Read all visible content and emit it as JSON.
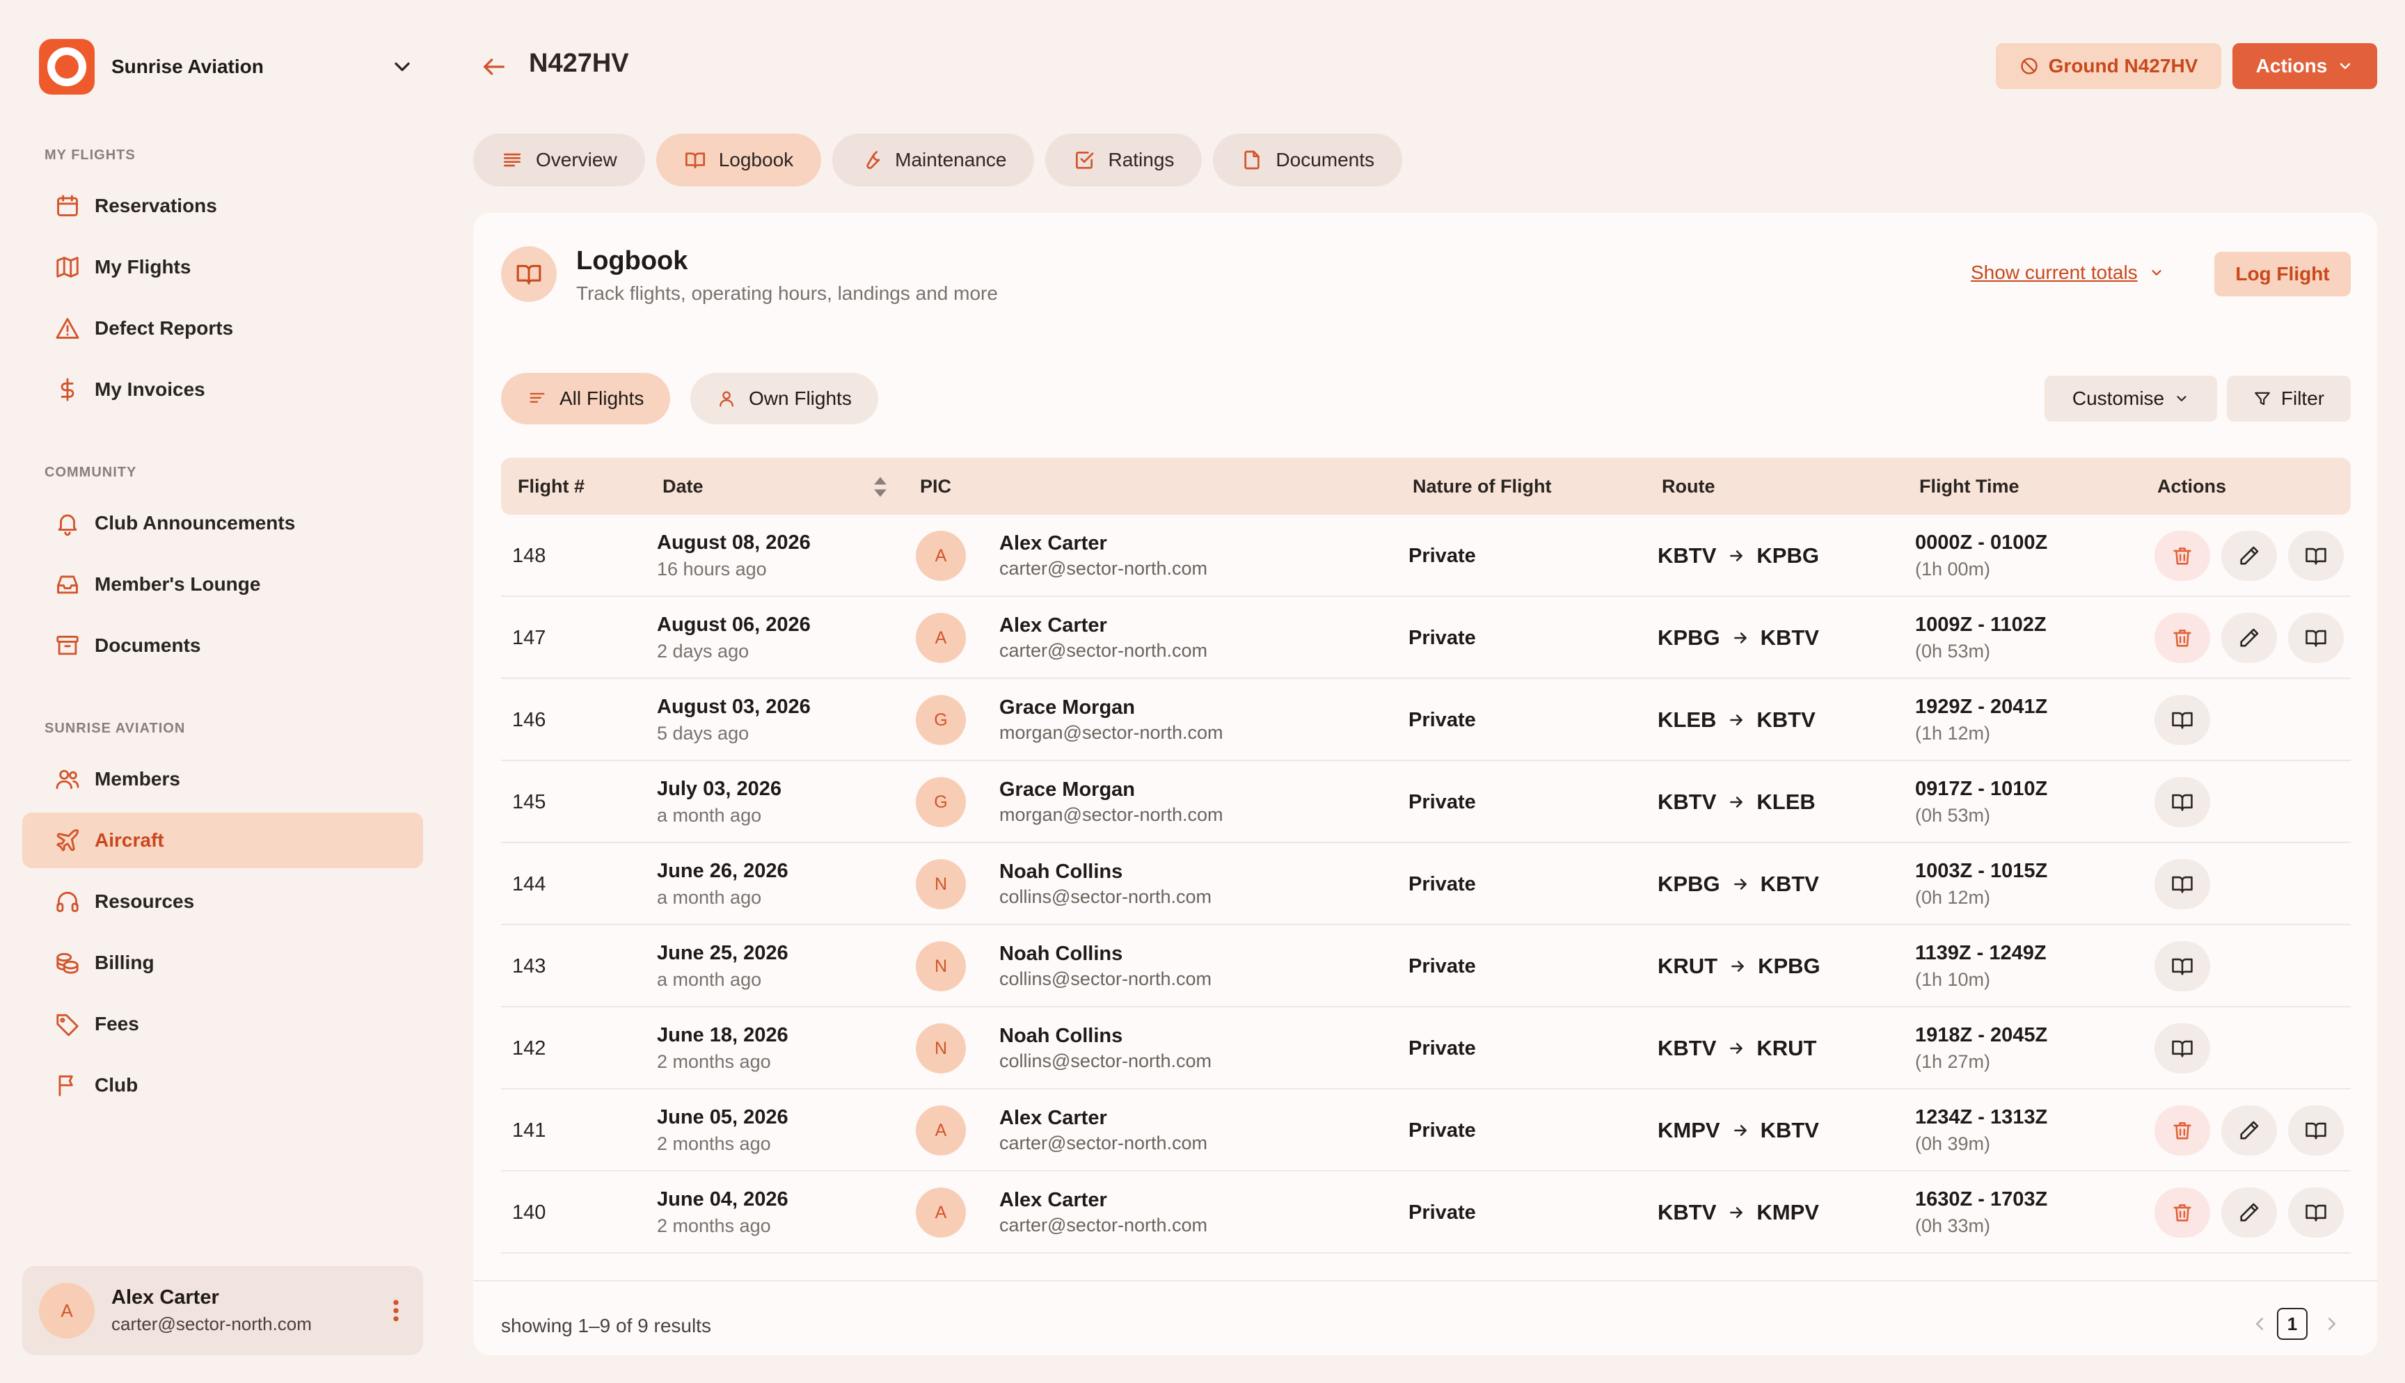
{
  "org": {
    "name": "Sunrise Aviation"
  },
  "sidebar": {
    "sections": [
      {
        "label": "MY FLIGHTS",
        "items": [
          {
            "label": "Reservations",
            "icon": "calendar-icon"
          },
          {
            "label": "My Flights",
            "icon": "map-icon"
          },
          {
            "label": "Defect Reports",
            "icon": "warning-icon"
          },
          {
            "label": "My Invoices",
            "icon": "dollar-icon"
          }
        ]
      },
      {
        "label": "COMMUNITY",
        "items": [
          {
            "label": "Club Announcements",
            "icon": "bell-icon"
          },
          {
            "label": "Member's Lounge",
            "icon": "inbox-icon"
          },
          {
            "label": "Documents",
            "icon": "archive-icon"
          }
        ]
      },
      {
        "label": "SUNRISE AVIATION",
        "items": [
          {
            "label": "Members",
            "icon": "users-icon"
          },
          {
            "label": "Aircraft",
            "icon": "plane-icon",
            "active": true
          },
          {
            "label": "Resources",
            "icon": "headphones-icon"
          },
          {
            "label": "Billing",
            "icon": "coins-icon"
          },
          {
            "label": "Fees",
            "icon": "tag-icon"
          },
          {
            "label": "Club",
            "icon": "flag-icon"
          }
        ]
      }
    ]
  },
  "user": {
    "initial": "A",
    "name": "Alex Carter",
    "email": "carter@sector-north.com"
  },
  "header": {
    "title": "N427HV",
    "ground_label": "Ground N427HV",
    "actions_label": "Actions"
  },
  "tabs": [
    {
      "label": "Overview",
      "icon": "lines-icon"
    },
    {
      "label": "Logbook",
      "icon": "book-icon",
      "active": true
    },
    {
      "label": "Maintenance",
      "icon": "wrench-icon"
    },
    {
      "label": "Ratings",
      "icon": "check-square-icon"
    },
    {
      "label": "Documents",
      "icon": "file-icon"
    }
  ],
  "logbook": {
    "title": "Logbook",
    "subtitle": "Track flights, operating hours, landings and more",
    "show_totals": "Show current totals",
    "log_flight": "Log Flight",
    "filters": {
      "all": "All Flights",
      "own": "Own Flights"
    },
    "customise": "Customise",
    "filter": "Filter",
    "columns": [
      "Flight #",
      "Date",
      "PIC",
      "Nature of Flight",
      "Route",
      "Flight Time",
      "Actions"
    ],
    "rows": [
      {
        "num": "148",
        "date": "August 08, 2026",
        "ago": "16 hours ago",
        "initial": "A",
        "pic": "Alex Carter",
        "email": "carter@sector-north.com",
        "nature": "Private",
        "from": "KBTV",
        "to": "KPBG",
        "time": "0000Z - 0100Z",
        "dur": "(1h 00m)",
        "editable": true
      },
      {
        "num": "147",
        "date": "August 06, 2026",
        "ago": "2 days ago",
        "initial": "A",
        "pic": "Alex Carter",
        "email": "carter@sector-north.com",
        "nature": "Private",
        "from": "KPBG",
        "to": "KBTV",
        "time": "1009Z - 1102Z",
        "dur": "(0h 53m)",
        "editable": true
      },
      {
        "num": "146",
        "date": "August 03, 2026",
        "ago": "5 days ago",
        "initial": "G",
        "pic": "Grace Morgan",
        "email": "morgan@sector-north.com",
        "nature": "Private",
        "from": "KLEB",
        "to": "KBTV",
        "time": "1929Z - 2041Z",
        "dur": "(1h 12m)",
        "editable": false
      },
      {
        "num": "145",
        "date": "July 03, 2026",
        "ago": "a month ago",
        "initial": "G",
        "pic": "Grace Morgan",
        "email": "morgan@sector-north.com",
        "nature": "Private",
        "from": "KBTV",
        "to": "KLEB",
        "time": "0917Z - 1010Z",
        "dur": "(0h 53m)",
        "editable": false
      },
      {
        "num": "144",
        "date": "June 26, 2026",
        "ago": "a month ago",
        "initial": "N",
        "pic": "Noah Collins",
        "email": "collins@sector-north.com",
        "nature": "Private",
        "from": "KPBG",
        "to": "KBTV",
        "time": "1003Z - 1015Z",
        "dur": "(0h 12m)",
        "editable": false
      },
      {
        "num": "143",
        "date": "June 25, 2026",
        "ago": "a month ago",
        "initial": "N",
        "pic": "Noah Collins",
        "email": "collins@sector-north.com",
        "nature": "Private",
        "from": "KRUT",
        "to": "KPBG",
        "time": "1139Z - 1249Z",
        "dur": "(1h 10m)",
        "editable": false
      },
      {
        "num": "142",
        "date": "June 18, 2026",
        "ago": "2 months ago",
        "initial": "N",
        "pic": "Noah Collins",
        "email": "collins@sector-north.com",
        "nature": "Private",
        "from": "KBTV",
        "to": "KRUT",
        "time": "1918Z - 2045Z",
        "dur": "(1h 27m)",
        "editable": false
      },
      {
        "num": "141",
        "date": "June 05, 2026",
        "ago": "2 months ago",
        "initial": "A",
        "pic": "Alex Carter",
        "email": "carter@sector-north.com",
        "nature": "Private",
        "from": "KMPV",
        "to": "KBTV",
        "time": "1234Z - 1313Z",
        "dur": "(0h 39m)",
        "editable": true
      },
      {
        "num": "140",
        "date": "June 04, 2026",
        "ago": "2 months ago",
        "initial": "A",
        "pic": "Alex Carter",
        "email": "carter@sector-north.com",
        "nature": "Private",
        "from": "KBTV",
        "to": "KMPV",
        "time": "1630Z - 1703Z",
        "dur": "(0h 33m)",
        "editable": true
      }
    ],
    "showing": "showing 1–9 of 9 results",
    "page": "1"
  },
  "colors": {
    "accent": "#e2603a",
    "accent_soft": "#f8d3bf",
    "background": "#f9f1ee",
    "danger": "#e2603a"
  }
}
